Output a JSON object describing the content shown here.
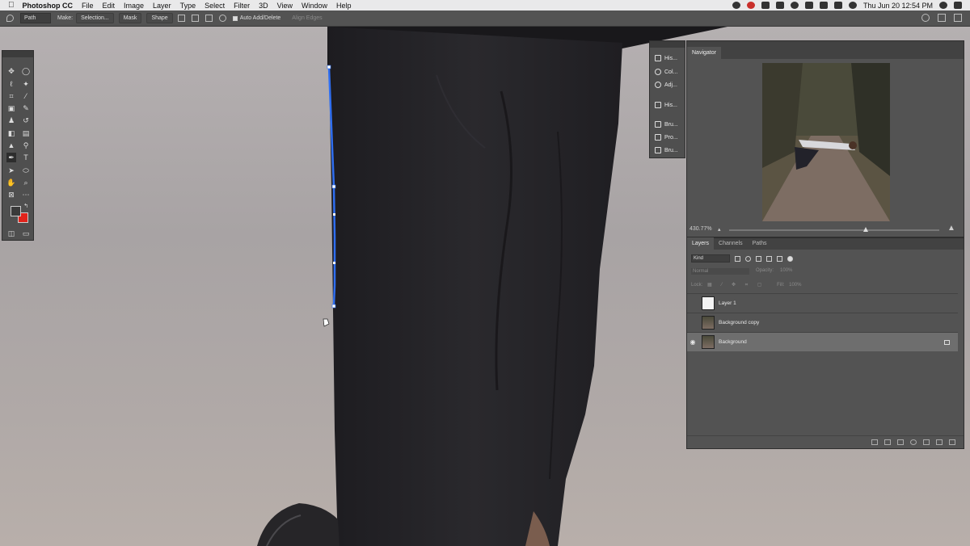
{
  "menubar": {
    "app_name": "Photoshop CC",
    "items": [
      "File",
      "Edit",
      "Image",
      "Layer",
      "Type",
      "Select",
      "Filter",
      "3D",
      "View",
      "Window",
      "Help"
    ],
    "clock": "Thu Jun 20  12:54 PM"
  },
  "options": {
    "mode": "Path",
    "make_label": "Make:",
    "selection_btn": "Selection...",
    "mask_btn": "Mask",
    "shape_btn": "Shape",
    "auto_add_delete": "Auto Add/Delete",
    "align_edges": "Align Edges"
  },
  "panelstrip": {
    "items": [
      "His...",
      "Col...",
      "Adj...",
      "His...",
      "Bru...",
      "Pro...",
      "Bru..."
    ]
  },
  "navigator": {
    "tab": "Navigator",
    "zoom": "430.77%"
  },
  "layers": {
    "tabs": [
      "Layers",
      "Channels",
      "Paths"
    ],
    "kind": "Kind",
    "blend_mode": "Normal",
    "opacity_label": "Opacity:",
    "opacity_value": "100%",
    "lock_label": "Lock:",
    "fill_label": "Fill:",
    "fill_value": "100%",
    "items": [
      {
        "name": "Layer 1"
      },
      {
        "name": "Background copy"
      },
      {
        "name": "Background"
      }
    ]
  }
}
